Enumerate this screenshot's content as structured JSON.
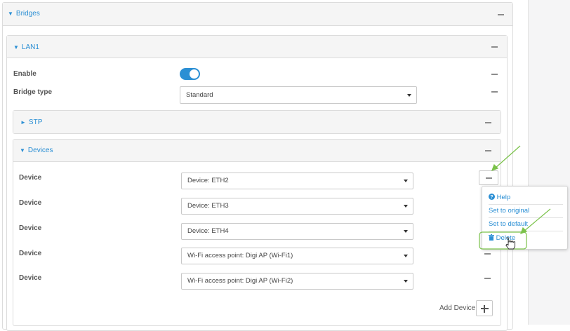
{
  "bridges": {
    "title": "Bridges",
    "tri": "▼"
  },
  "lan": {
    "title": "LAN1",
    "tri": "▼"
  },
  "enable": {
    "label": "Enable",
    "checked": true
  },
  "bridge_type": {
    "label": "Bridge type",
    "value": "Standard"
  },
  "stp": {
    "title": "STP",
    "tri": "►"
  },
  "devices": {
    "title": "Devices",
    "tri": "▼",
    "rows": [
      {
        "label": "Device",
        "value": "Device: ETH2"
      },
      {
        "label": "Device",
        "value": "Device: ETH3"
      },
      {
        "label": "Device",
        "value": "Device: ETH4"
      },
      {
        "label": "Device",
        "value": "Wi-Fi access point: Digi AP (Wi-Fi1)"
      },
      {
        "label": "Device",
        "value": "Wi-Fi access point: Digi AP (Wi-Fi2)"
      }
    ],
    "add_label": "Add Device"
  },
  "context_menu": {
    "help": "Help",
    "help_icon": "question-circle-icon",
    "set_original": "Set to original",
    "set_default": "Set to default",
    "delete": "Delete",
    "delete_icon": "trash-icon"
  },
  "colors": {
    "accent": "#2b8fd4",
    "annotation": "#7bc24a"
  }
}
